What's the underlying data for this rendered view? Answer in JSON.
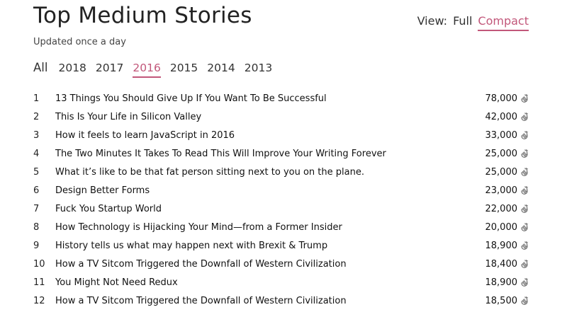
{
  "header": {
    "title": "Top Medium Stories",
    "subtitle": "Updated once a day",
    "view_label": "View:",
    "view_full": "Full",
    "view_compact": "Compact",
    "active_view": "Compact"
  },
  "tabs": [
    "All",
    "2018",
    "2017",
    "2016",
    "2015",
    "2014",
    "2013"
  ],
  "active_tab": "2016",
  "accent_color": "#c2577a",
  "clap_icon": "clap-icon",
  "stories": [
    {
      "rank": "1",
      "title": "13 Things You Should Give Up If You Want To Be Successful",
      "claps": "78,000"
    },
    {
      "rank": "2",
      "title": "This Is Your Life in Silicon Valley",
      "claps": "42,000"
    },
    {
      "rank": "3",
      "title": "How it feels to learn JavaScript in 2016",
      "claps": "33,000"
    },
    {
      "rank": "4",
      "title": "The Two Minutes It Takes To Read This Will Improve Your Writing Forever",
      "claps": "25,000"
    },
    {
      "rank": "5",
      "title": "What it’s like to be that fat person sitting next to you on the plane.",
      "claps": "25,000"
    },
    {
      "rank": "6",
      "title": "Design Better Forms",
      "claps": "23,000"
    },
    {
      "rank": "7",
      "title": "Fuck You Startup World",
      "claps": "22,000"
    },
    {
      "rank": "8",
      "title": "How Technology is Hijacking Your Mind—from a Former Insider",
      "claps": "20,000"
    },
    {
      "rank": "9",
      "title": "History tells us what may happen next with Brexit & Trump",
      "claps": "18,900"
    },
    {
      "rank": "10",
      "title": "How a TV Sitcom Triggered the Downfall of Western Civilization",
      "claps": "18,400"
    },
    {
      "rank": "11",
      "title": "You Might Not Need Redux",
      "claps": "18,900"
    },
    {
      "rank": "12",
      "title": "How a TV Sitcom Triggered the Downfall of Western Civilization",
      "claps": "18,500"
    }
  ]
}
